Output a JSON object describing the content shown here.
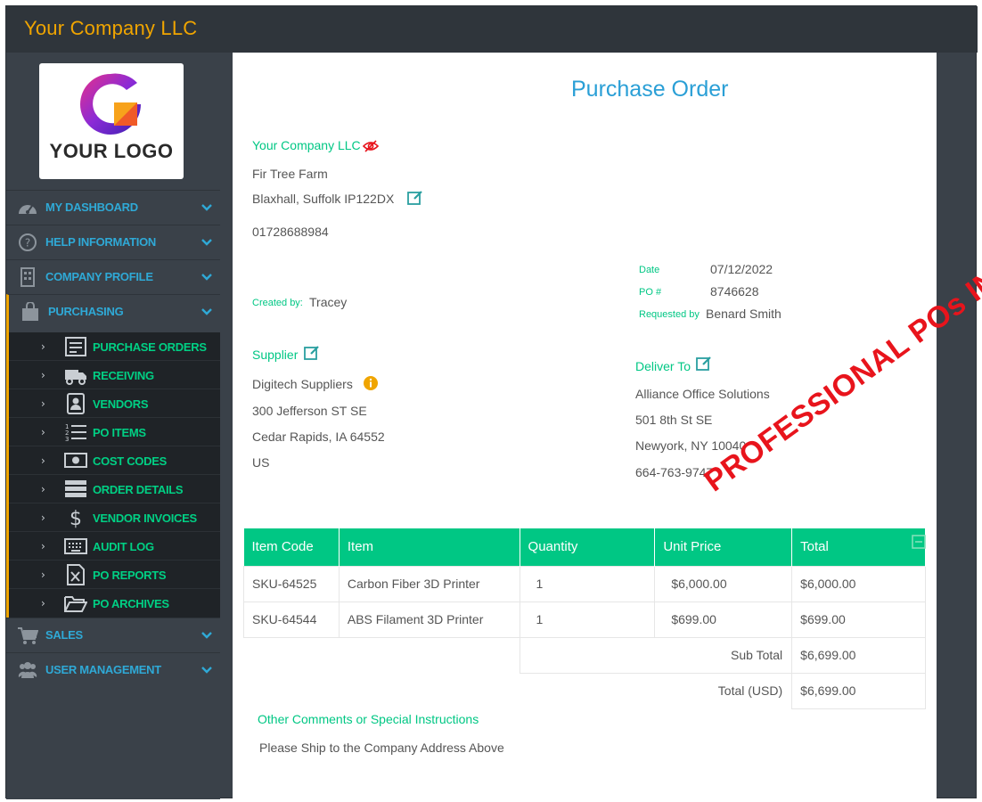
{
  "app": {
    "title": "Your Company LLC"
  },
  "logo": {
    "text": "YOUR LOGO"
  },
  "sidebar": {
    "items": [
      {
        "label": "MY DASHBOARD",
        "icon": "dashboard-gauge-icon"
      },
      {
        "label": "HELP INFORMATION",
        "icon": "question-circle-icon"
      },
      {
        "label": "COMPANY PROFILE",
        "icon": "building-icon"
      },
      {
        "label": "PURCHASING",
        "icon": "shopping-bag-icon"
      },
      {
        "label": "SALES",
        "icon": "shopping-cart-icon"
      },
      {
        "label": "USER MANAGEMENT",
        "icon": "users-icon"
      }
    ],
    "submenu": [
      {
        "label": "PURCHASE ORDERS",
        "icon": "purchase-order-icon"
      },
      {
        "label": "RECEIVING",
        "icon": "truck-icon"
      },
      {
        "label": "VENDORS",
        "icon": "vendor-card-icon"
      },
      {
        "label": "PO ITEMS",
        "icon": "numbered-list-icon"
      },
      {
        "label": "COST CODES",
        "icon": "money-bill-icon"
      },
      {
        "label": "ORDER DETAILS",
        "icon": "server-stack-icon"
      },
      {
        "label": "VENDOR INVOICES",
        "icon": "dollar-icon"
      },
      {
        "label": "AUDIT LOG",
        "icon": "keyboard-icon"
      },
      {
        "label": "PO REPORTS",
        "icon": "excel-file-icon"
      },
      {
        "label": "PO ARCHIVES",
        "icon": "folder-open-icon"
      }
    ],
    "caret": "›"
  },
  "document": {
    "title": "Purchase Order",
    "company": {
      "name": "Your Company LLC",
      "address1": "Fir Tree Farm",
      "address2": "Blaxhall, Suffolk IP122DX",
      "phone": "01728688984"
    },
    "created_by_label": "Created by:",
    "created_by": "Tracey",
    "meta": {
      "date_label": "Date",
      "date": "07/12/2022",
      "po_label": "PO #",
      "po": "8746628",
      "requested_label": "Requested by",
      "requested": "Benard Smith"
    },
    "supplier": {
      "label": "Supplier",
      "name": "Digitech Suppliers",
      "address1": "300 Jefferson ST SE",
      "address2": "Cedar Rapids, IA 64552",
      "country": "US"
    },
    "deliver_to": {
      "label": "Deliver To",
      "name": "Alliance Office Solutions",
      "address1": "501 8th St SE",
      "address2": "Newyork, NY 10040",
      "phone": "664-763-9747"
    },
    "watermark": "PROFESSIONAL POs IN MINUTES",
    "table": {
      "headers": [
        "Item Code",
        "Item",
        "Quantity",
        "Unit Price",
        "Total"
      ],
      "rows": [
        [
          "SKU-64525",
          "Carbon Fiber 3D Printer",
          "1",
          "$6,000.00",
          "$6,000.00"
        ],
        [
          "SKU-64544",
          "ABS Filament 3D Printer",
          "1",
          "$699.00",
          "$699.00"
        ]
      ],
      "subtotal_label": "Sub Total",
      "subtotal": "$6,699.00",
      "total_label": "Total (USD)",
      "total": "$6,699.00"
    },
    "comments_label": "Other Comments or Special Instructions",
    "comments": "Please Ship to the Company Address Above"
  },
  "colors": {
    "accent_orange": "#f0a500",
    "nav_blue": "#2fa9d6",
    "green": "#00c784",
    "watermark_red": "#e8141c",
    "sidebar_bg": "#3a4149",
    "submenu_bg": "#1f2327"
  }
}
